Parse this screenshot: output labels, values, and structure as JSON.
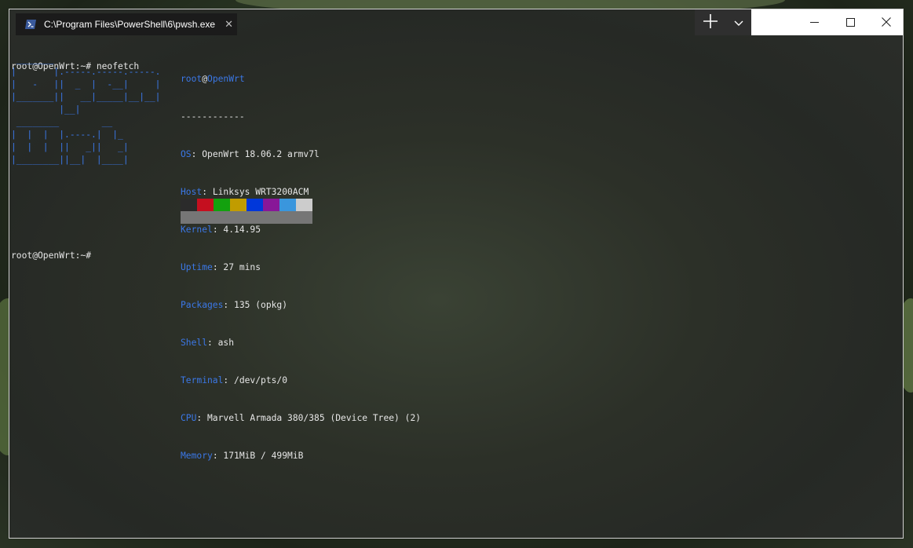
{
  "window": {
    "tab_title": "C:\\Program Files\\PowerShell\\6\\pwsh.exe",
    "tab_icon": "powershell-icon",
    "close_tab_glyph": "✕",
    "new_tab_icon": "plus-icon",
    "dropdown_icon": "chevron-down-icon",
    "caption_icons": [
      "minimize-icon",
      "maximize-icon",
      "close-icon"
    ]
  },
  "terminal": {
    "command_line": "root@OpenWrt:~# neofetch",
    "final_prompt": "root@OpenWrt:~# ",
    "ascii_logo": " _______\n|       |.-----.-----.-----.\n|   -   ||  _  |  -__|     |\n|_______||   __|_____|__|__|\n         |__|\n ________        __\n|  |  |  |.----.|  |_\n|  |  |  ||   _||   _|\n|________||__|  |____|",
    "neofetch": {
      "user": "root",
      "at": "@",
      "host": "OpenWrt",
      "separator": "------------",
      "rows": [
        {
          "key": "OS",
          "value": ": OpenWrt 18.06.2 armv7l"
        },
        {
          "key": "Host",
          "value": ": Linksys WRT3200ACM"
        },
        {
          "key": "Kernel",
          "value": ": 4.14.95"
        },
        {
          "key": "Uptime",
          "value": ": 27 mins"
        },
        {
          "key": "Packages",
          "value": ": 135 (opkg)"
        },
        {
          "key": "Shell",
          "value": ": ash"
        },
        {
          "key": "Terminal",
          "value": ": /dev/pts/0"
        },
        {
          "key": "CPU",
          "value": ": Marvell Armada 380/385 (Device Tree) (2)"
        },
        {
          "key": "Memory",
          "value": ": 171MiB / 499MiB"
        }
      ]
    },
    "colors": {
      "accent": "#3b78e7",
      "palette_row1": [
        "#2b2b2b",
        "#c50f1f",
        "#13a10e",
        "#c19c00",
        "#0037da",
        "#881798",
        "#3a96dd",
        "#cccccc"
      ],
      "palette_row2": [
        "#767676",
        "#767676",
        "#767676",
        "#767676",
        "#767676",
        "#767676",
        "#767676",
        "#767676"
      ]
    }
  }
}
